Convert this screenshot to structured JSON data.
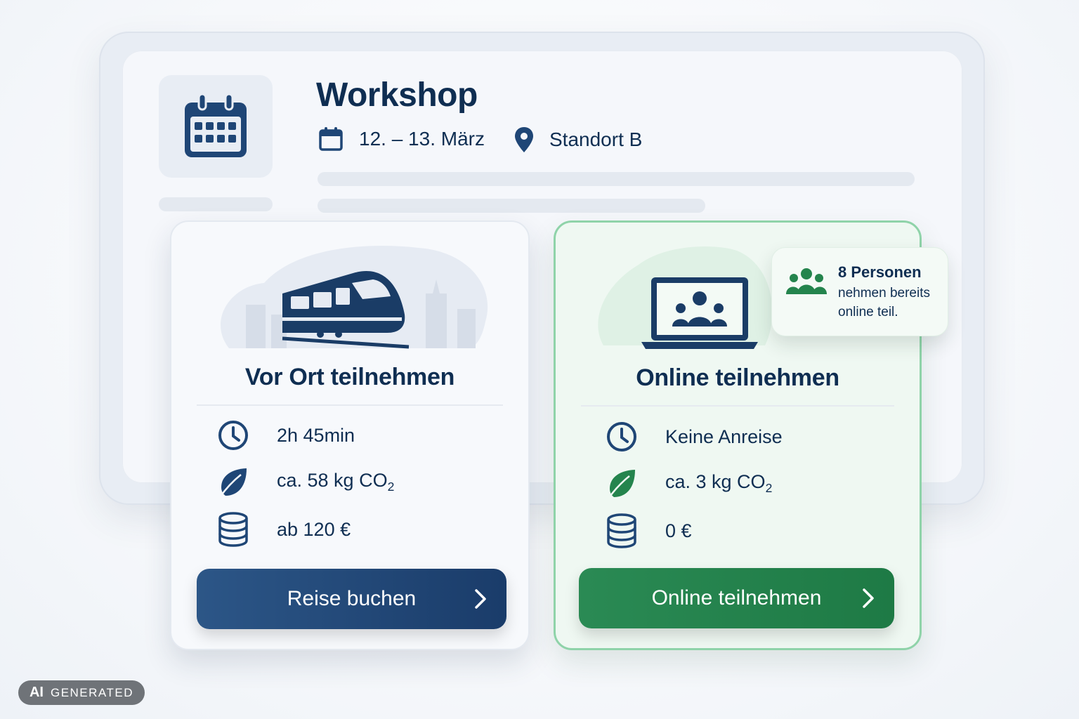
{
  "event": {
    "title": "Workshop",
    "date": "12. – 13. März",
    "location": "Standort B"
  },
  "onsite": {
    "title": "Vor Ort teilnehmen",
    "duration": "2h 45min",
    "co2_prefix": "ca. 58 kg CO",
    "co2_sub": "2",
    "cost": "ab 120 €",
    "button_label": "Reise buchen",
    "icon": "train-icon"
  },
  "online": {
    "title": "Online teilnehmen",
    "duration": "Keine Anreise",
    "co2_prefix": "ca. 3 kg CO",
    "co2_sub": "2",
    "cost": "0 €",
    "button_label": "Online teilnehmen",
    "icon": "laptop-video-call-icon"
  },
  "participants_bubble": {
    "count_label": "8 Personen",
    "line1": "nehmen bereits",
    "line2": "online teil."
  },
  "badge": {
    "ai": "AI",
    "text": "GENERATED"
  },
  "colors": {
    "navy": "#0f2e52",
    "button_blue": "#1f4676",
    "button_green": "#24844d",
    "accent_green_border": "#8fd3a9"
  }
}
